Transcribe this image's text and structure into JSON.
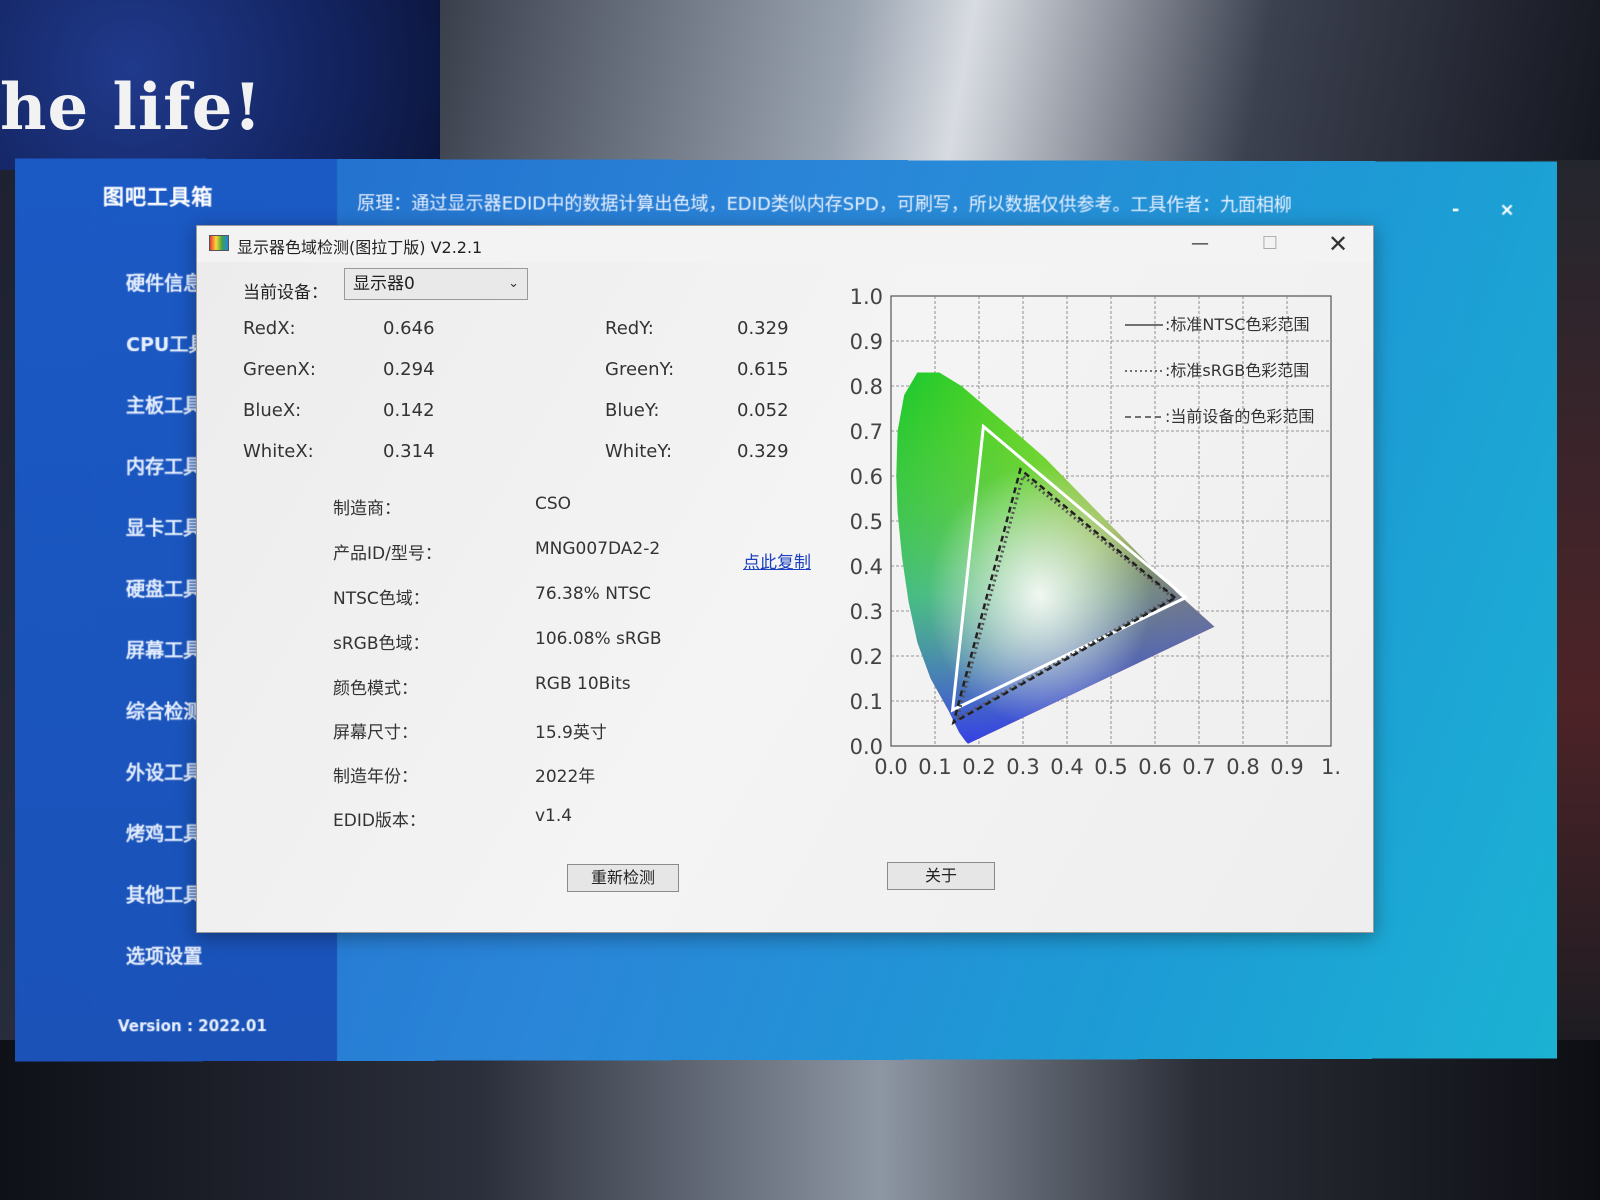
{
  "wallpaper": {
    "text": "he life!"
  },
  "app": {
    "title": "图吧工具箱",
    "banner": "原理：通过显示器EDID中的数据计算出色域，EDID类似内存SPD，可刷写，所以数据仅供参考。工具作者：九面相柳",
    "minimize_label": "-",
    "close_label": "×",
    "nav": [
      {
        "label": "硬件信息"
      },
      {
        "label": "CPU工具"
      },
      {
        "label": "主板工具"
      },
      {
        "label": "内存工具"
      },
      {
        "label": "显卡工具"
      },
      {
        "label": "硬盘工具"
      },
      {
        "label": "屏幕工具"
      },
      {
        "label": "综合检测"
      },
      {
        "label": "外设工具"
      },
      {
        "label": "烤鸡工具"
      },
      {
        "label": "其他工具"
      },
      {
        "label": "选项设置"
      }
    ],
    "version": "Version : 2022.01"
  },
  "dialog": {
    "title": "显示器色域检测(图拉丁版) V2.2.1",
    "device_label": "当前设备：",
    "device_value": "显示器0",
    "coords": {
      "red_x_label": "RedX:",
      "red_x": "0.646",
      "red_y_label": "RedY:",
      "red_y": "0.329",
      "green_x_label": "GreenX:",
      "green_x": "0.294",
      "green_y_label": "GreenY:",
      "green_y": "0.615",
      "blue_x_label": "BlueX:",
      "blue_x": "0.142",
      "blue_y_label": "BlueY:",
      "blue_y": "0.052",
      "white_x_label": "WhiteX:",
      "white_x": "0.314",
      "white_y_label": "WhiteY:",
      "white_y": "0.329"
    },
    "info": [
      {
        "label": "制造商：",
        "value": "CSO"
      },
      {
        "label": "产品ID/型号：",
        "value": "MNG007DA2-2"
      },
      {
        "label": "NTSC色域：",
        "value": "76.38% NTSC"
      },
      {
        "label": "sRGB色域：",
        "value": "106.08% sRGB"
      },
      {
        "label": "颜色模式：",
        "value": "RGB 10Bits"
      },
      {
        "label": "屏幕尺寸：",
        "value": "15.9英寸"
      },
      {
        "label": "制造年份：",
        "value": "2022年"
      },
      {
        "label": "EDID版本：",
        "value": "v1.4"
      }
    ],
    "copy_link": "点此复制",
    "redetect_button": "重新检测",
    "about_button": "关于"
  },
  "chart_data": {
    "type": "scatter",
    "xlim": [
      0,
      1
    ],
    "ylim": [
      0,
      1
    ],
    "x_ticks": [
      "0.0",
      "0.1",
      "0.2",
      "0.3",
      "0.4",
      "0.5",
      "0.6",
      "0.7",
      "0.8",
      "0.9",
      "1."
    ],
    "y_ticks": [
      "0.0",
      "0.1",
      "0.2",
      "0.3",
      "0.4",
      "0.5",
      "0.6",
      "0.7",
      "0.8",
      "0.9",
      "1.0"
    ],
    "grid": true,
    "legend_position": "top-right",
    "legend": [
      "标准NTSC色彩范围",
      "标准sRGB色彩范围",
      "当前设备的色彩范围"
    ],
    "triangles": {
      "ntsc": [
        [
          0.67,
          0.33
        ],
        [
          0.21,
          0.71
        ],
        [
          0.14,
          0.08
        ]
      ],
      "srgb": [
        [
          0.64,
          0.33
        ],
        [
          0.3,
          0.6
        ],
        [
          0.15,
          0.06
        ]
      ],
      "device": [
        [
          0.646,
          0.329
        ],
        [
          0.294,
          0.615
        ],
        [
          0.142,
          0.052
        ]
      ]
    },
    "colors": {
      "ntsc": "#ffffff",
      "srgb": "#555555",
      "device": "#222222"
    }
  }
}
